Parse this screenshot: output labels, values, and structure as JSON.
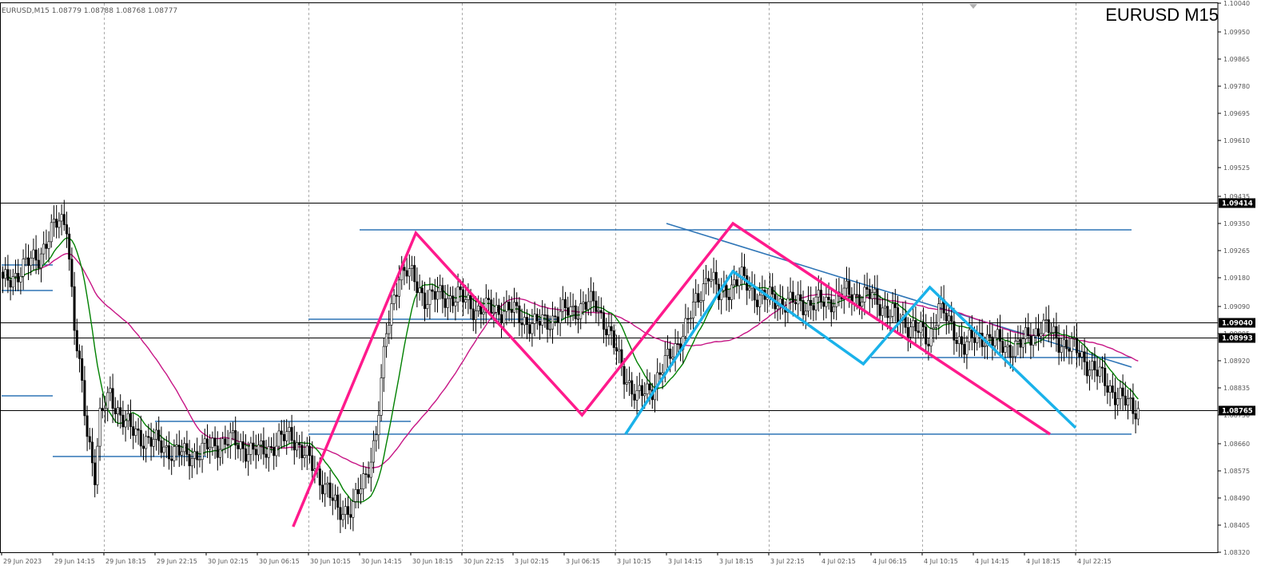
{
  "header": {
    "info": "EURUSD,M15  1.08779 1.08788 1.08768 1.08777",
    "symbol_title": "EURUSD M15"
  },
  "chart_data": {
    "type": "candlestick",
    "symbol": "EURUSD",
    "timeframe": "M15",
    "ylim": [
      1.0832,
      1.1004
    ],
    "price_ticks": [
      "1.10040",
      "1.09950",
      "1.09865",
      "1.09780",
      "1.09695",
      "1.09610",
      "1.09525",
      "1.09435",
      "1.09350",
      "1.09265",
      "1.09180",
      "1.09090",
      "1.09005",
      "1.08920",
      "1.08835",
      "1.08750",
      "1.08660",
      "1.08575",
      "1.08490",
      "1.08405",
      "1.08320"
    ],
    "time_ticks": [
      "29 Jun 2023",
      "29 Jun 14:15",
      "29 Jun 18:15",
      "29 Jun 22:15",
      "30 Jun 02:15",
      "30 Jun 06:15",
      "30 Jun 10:15",
      "30 Jun 14:15",
      "30 Jun 18:15",
      "30 Jun 22:15",
      "3 Jul 02:15",
      "3 Jul 06:15",
      "3 Jul 10:15",
      "3 Jul 14:15",
      "3 Jul 18:15",
      "3 Jul 22:15",
      "4 Jul 02:15",
      "4 Jul 06:15",
      "4 Jul 10:15",
      "4 Jul 14:15",
      "4 Jul 18:15",
      "4 Jul 22:15"
    ],
    "period_separators": [
      "29 Jun 18:15",
      "30 Jun 10:15",
      "30 Jun 22:15",
      "3 Jul 10:15",
      "3 Jul 22:15",
      "4 Jul 10:15",
      "4 Jul 22:15"
    ],
    "horizontal_levels": [
      {
        "price": "1.09414",
        "style": "black",
        "label_bg": "#000000",
        "label_color": "#ffffff"
      },
      {
        "price": "1.09040",
        "style": "black",
        "label_bg": "#000000",
        "label_color": "#ffffff"
      },
      {
        "price": "1.08993",
        "style": "black",
        "label_bg": "#000000",
        "label_color": "#ffffff"
      },
      {
        "price": "1.08765",
        "style": "current",
        "label_bg": "#000000",
        "label_color": "#ffffff"
      }
    ],
    "ohlc_anchors": [
      {
        "t": 0,
        "p": 1.0916
      },
      {
        "t": 14,
        "p": 1.0925
      },
      {
        "t": 22,
        "p": 1.0936
      },
      {
        "t": 25,
        "p": 1.0936
      },
      {
        "t": 28,
        "p": 1.0902
      },
      {
        "t": 33,
        "p": 1.087
      },
      {
        "t": 36,
        "p": 1.0857
      },
      {
        "t": 38,
        "p": 1.0874
      },
      {
        "t": 42,
        "p": 1.0881
      },
      {
        "t": 50,
        "p": 1.087
      },
      {
        "t": 60,
        "p": 1.0866
      },
      {
        "t": 72,
        "p": 1.0862
      },
      {
        "t": 88,
        "p": 1.0867
      },
      {
        "t": 100,
        "p": 1.0863
      },
      {
        "t": 113,
        "p": 1.0869
      },
      {
        "t": 120,
        "p": 1.086
      },
      {
        "t": 127,
        "p": 1.0852
      },
      {
        "t": 131,
        "p": 1.0844
      },
      {
        "t": 137,
        "p": 1.0847
      },
      {
        "t": 142,
        "p": 1.0855
      },
      {
        "t": 146,
        "p": 1.087
      },
      {
        "t": 150,
        "p": 1.09
      },
      {
        "t": 155,
        "p": 1.092
      },
      {
        "t": 158,
        "p": 1.092
      },
      {
        "t": 165,
        "p": 1.0912
      },
      {
        "t": 178,
        "p": 1.0912
      },
      {
        "t": 186,
        "p": 1.0908
      },
      {
        "t": 198,
        "p": 1.0908
      },
      {
        "t": 208,
        "p": 1.0903
      },
      {
        "t": 222,
        "p": 1.0908
      },
      {
        "t": 232,
        "p": 1.091
      },
      {
        "t": 236,
        "p": 1.0903
      },
      {
        "t": 242,
        "p": 1.089
      },
      {
        "t": 248,
        "p": 1.088
      },
      {
        "t": 254,
        "p": 1.0884
      },
      {
        "t": 260,
        "p": 1.0892
      },
      {
        "t": 268,
        "p": 1.0904
      },
      {
        "t": 276,
        "p": 1.092
      },
      {
        "t": 280,
        "p": 1.0912
      },
      {
        "t": 288,
        "p": 1.0918
      },
      {
        "t": 296,
        "p": 1.0912
      },
      {
        "t": 308,
        "p": 1.091
      },
      {
        "t": 320,
        "p": 1.091
      },
      {
        "t": 330,
        "p": 1.0913
      },
      {
        "t": 340,
        "p": 1.0912
      },
      {
        "t": 350,
        "p": 1.0905
      },
      {
        "t": 356,
        "p": 1.0903
      },
      {
        "t": 362,
        "p": 1.0898
      },
      {
        "t": 366,
        "p": 1.091
      },
      {
        "t": 370,
        "p": 1.0903
      },
      {
        "t": 376,
        "p": 1.0897
      },
      {
        "t": 384,
        "p": 1.09
      },
      {
        "t": 392,
        "p": 1.0896
      },
      {
        "t": 398,
        "p": 1.0897
      },
      {
        "t": 406,
        "p": 1.0903
      },
      {
        "t": 414,
        "p": 1.0898
      },
      {
        "t": 420,
        "p": 1.0895
      },
      {
        "t": 428,
        "p": 1.0888
      },
      {
        "t": 436,
        "p": 1.0881
      },
      {
        "t": 440,
        "p": 1.0878
      },
      {
        "t": 444,
        "p": 1.0877
      }
    ],
    "sma_fast": {
      "color": "#008000",
      "period": "fast"
    },
    "sma_slow": {
      "color": "#c71585",
      "period": "slow"
    },
    "trendlines": [
      {
        "name": "support-low-29jun",
        "color": "#2e75b6",
        "from": [
          "29 Jun 14:15",
          1.0862
        ],
        "to": [
          "30 Jun 02:15",
          1.0862
        ]
      },
      {
        "name": "res-left-top",
        "color": "#2e75b6",
        "from": [
          "29 Jun 2023",
          1.0922
        ],
        "to": [
          "29 Jun 14:15",
          1.0922
        ]
      },
      {
        "name": "res-left-mid",
        "color": "#2e75b6",
        "from": [
          "29 Jun 2023",
          1.0914
        ],
        "to": [
          "29 Jun 14:15",
          1.0914
        ]
      },
      {
        "name": "support-left",
        "color": "#2e75b6",
        "from": [
          "29 Jun 2023",
          1.0881
        ],
        "to": [
          "29 Jun 14:15",
          1.0881
        ]
      },
      {
        "name": "mid-range-30jun",
        "color": "#2e75b6",
        "from": [
          "29 Jun 22:15",
          1.0873
        ],
        "to": [
          "30 Jun 18:15",
          1.0873
        ]
      },
      {
        "name": "top-range",
        "color": "#2e75b6",
        "from": [
          "30 Jun 14:15",
          1.0933
        ],
        "to": [
          "4 Jul 22:15",
          1.0933
        ]
      },
      {
        "name": "mid-range-30jun-3jul",
        "color": "#2e75b6",
        "from": [
          "30 Jun 10:15",
          1.0905
        ],
        "to": [
          "3 Jul 06:15",
          1.0905
        ]
      },
      {
        "name": "bottom-range",
        "color": "#2e75b6",
        "from": [
          "30 Jun 10:15",
          1.0869
        ],
        "to": [
          "4 Jul 22:15",
          1.0869
        ]
      },
      {
        "name": "descending-trendline",
        "color": "#2e75b6",
        "from": [
          "3 Jul 14:15",
          1.0935
        ],
        "to": [
          "4 Jul 22:15",
          1.089
        ]
      },
      {
        "name": "support-4jul",
        "color": "#2e75b6",
        "from": [
          "4 Jul 06:15",
          1.0893
        ],
        "to": [
          "4 Jul 22:15",
          1.0893
        ]
      }
    ],
    "zigzag_magenta": {
      "color": "#ff1a8c"
    },
    "zigzag_cyan": {
      "color": "#1ab2ea"
    }
  }
}
